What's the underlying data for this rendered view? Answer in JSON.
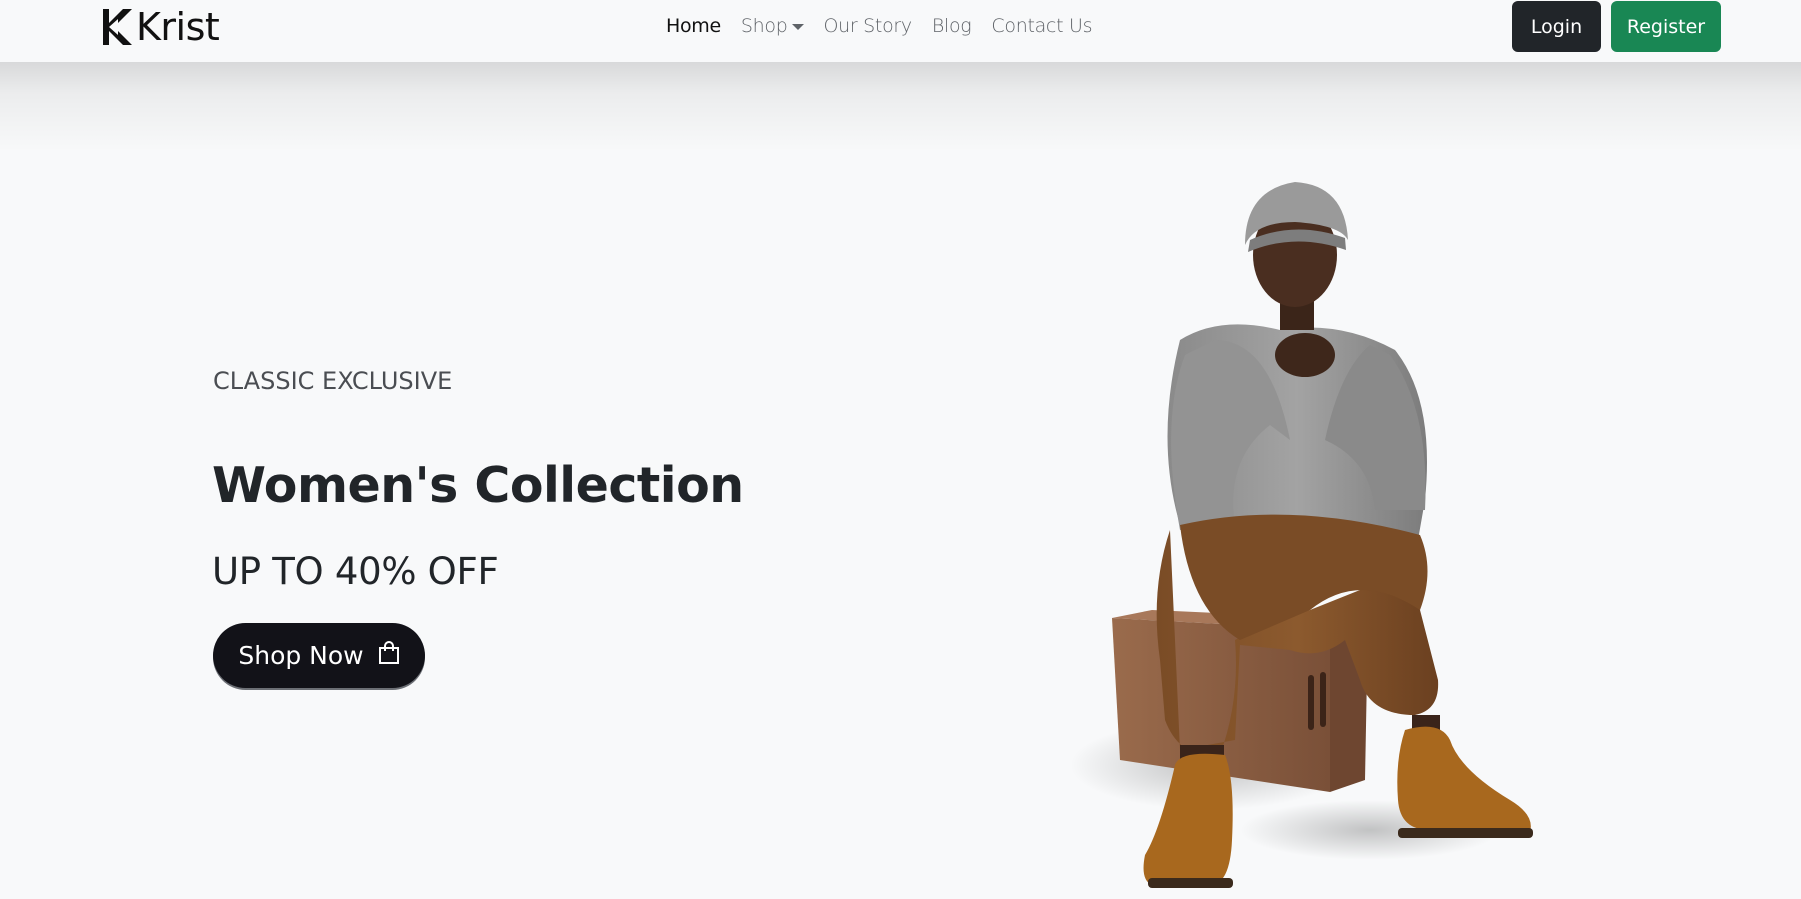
{
  "brand": {
    "name": "Krist",
    "logo_icon": "krist-k-logo-icon"
  },
  "nav": {
    "items": [
      {
        "label": "Home",
        "active": true
      },
      {
        "label": "Shop",
        "has_dropdown": true,
        "icon": "caret-down-icon"
      },
      {
        "label": "Our Story"
      },
      {
        "label": "Blog"
      },
      {
        "label": "Contact Us"
      }
    ],
    "login_label": "Login",
    "register_label": "Register"
  },
  "hero": {
    "subtitle": "CLASSIC EXCLUSIVE",
    "title": "Women's Collection",
    "offer": "UP TO 40% OFF",
    "cta_label": "Shop Now",
    "cta_icon": "shopping-bag-icon",
    "image": "model-seated-on-box"
  },
  "colors": {
    "background": "#f8f9fa",
    "login_button": "#212529",
    "register_button": "#198754",
    "cta_button": "#121218",
    "text_dark": "#212529",
    "text_muted": "#5f6368"
  }
}
